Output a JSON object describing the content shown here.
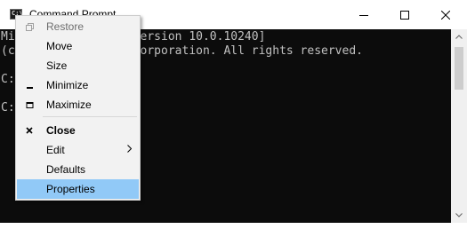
{
  "window": {
    "title": "Command Prompt",
    "minimize_glyph": "minimize-icon",
    "maximize_glyph": "maximize-icon",
    "close_glyph": "close-icon"
  },
  "console": {
    "lines": [
      "Microsoft Windows [Version 10.0.10240]",
      "(c) 2015 Microsoft Corporation. All rights reserved.",
      "",
      "C:\\>",
      "",
      "C:\\>"
    ]
  },
  "system_menu": {
    "items": [
      {
        "label": "Restore",
        "icon": "restore-icon",
        "state": "disabled"
      },
      {
        "label": "Move",
        "icon": "",
        "state": "normal"
      },
      {
        "label": "Size",
        "icon": "",
        "state": "normal"
      },
      {
        "label": "Minimize",
        "icon": "minimize-icon",
        "state": "normal"
      },
      {
        "label": "Maximize",
        "icon": "maximize-icon",
        "state": "normal"
      },
      {
        "label": "Close",
        "icon": "close-icon",
        "state": "default-bold"
      },
      {
        "label": "Edit",
        "icon": "",
        "state": "submenu"
      },
      {
        "label": "Defaults",
        "icon": "",
        "state": "normal"
      },
      {
        "label": "Properties",
        "icon": "",
        "state": "highlighted"
      }
    ]
  },
  "colors": {
    "console_background": "#0c0c0c",
    "console_text": "#c0c0c0",
    "menu_background": "#f2f2f2",
    "menu_highlight": "#91c9f7",
    "disabled_text": "#6d6d6d"
  }
}
